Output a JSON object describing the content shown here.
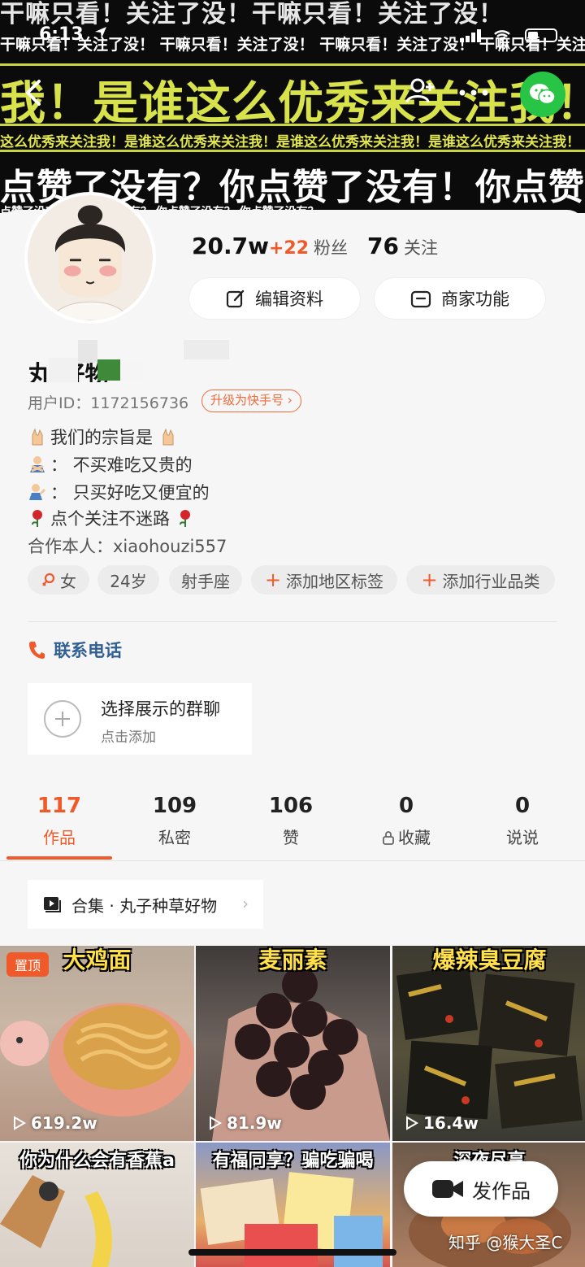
{
  "status_bar": {
    "time": "6:13"
  },
  "banner": {
    "row1": "干嘛只看！关注了没！干嘛只看！关注了没！",
    "row2": "干嘛只看！关注了没！ 干嘛只看！关注了没！ 干嘛只看！关注了没！ 干嘛只看！关注了没！",
    "row3": "我！是谁这么优秀来关注我！",
    "row4": "这么优秀来关注我！是谁这么优秀来关注我！是谁这么优秀来关注我！是谁这么优秀来关注我！",
    "row5": "点赞了没有？你点赞了没有！你点赞了",
    "row6": "点赞了没有？ 你点赞了没有？ 你点赞了没有？ 你点赞了没有？"
  },
  "profile": {
    "fans_count": "20.7w",
    "fans_delta": "+22",
    "fans_label": "粉丝",
    "follow_count": "76",
    "follow_label": "关注",
    "edit_label": "编辑资料",
    "shop_label": "商家功能",
    "name": "丸        好物",
    "user_id": "用户ID：1172156736",
    "upgrade": "升级为快手号 ›",
    "bio": [
      "我们的宗旨是",
      "：  不买难吃又贵的",
      "：  只买好吃又便宜的",
      "点个关注不迷路",
      "合作本人：xiaohouzi557"
    ],
    "tags": {
      "sex": "女",
      "age": "24岁",
      "zodiac": "射手座",
      "area": "添加地区标签",
      "industry": "添加行业品类"
    },
    "contact": "联系电话",
    "group_title": "选择展示的群聊",
    "group_sub": "点击添加"
  },
  "tabs": [
    {
      "count": "117",
      "label": "作品"
    },
    {
      "count": "109",
      "label": "私密"
    },
    {
      "count": "106",
      "label": "赞"
    },
    {
      "count": "0",
      "label": "收藏"
    },
    {
      "count": "0",
      "label": "说说"
    }
  ],
  "collection": "合集 · 丸子种草好物",
  "videos": [
    {
      "title": "大鸡面",
      "views": "619.2w",
      "pinned": "置顶"
    },
    {
      "title": "麦丽素",
      "views": "81.9w"
    },
    {
      "title": "爆辣臭豆腐",
      "views": "16.4w"
    },
    {
      "title": "你为什么会有香蕉a"
    },
    {
      "title": "有福同享？骗吃骗喝"
    },
    {
      "title": "深夜尽享"
    }
  ],
  "post_button": "发作品",
  "watermark": "知乎 @猴大圣C",
  "colors": {
    "accent": "#f05a2a",
    "banner_yellow": "#d8e24a",
    "contact_blue": "#2f5f93",
    "wechat_green": "#28c445"
  }
}
